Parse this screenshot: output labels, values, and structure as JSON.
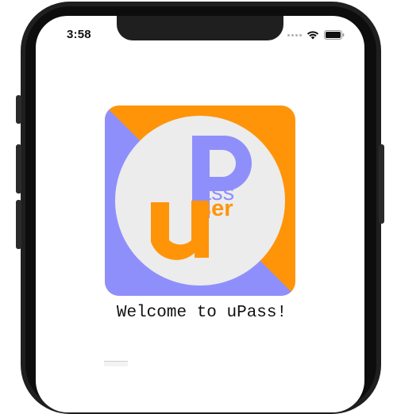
{
  "status_bar": {
    "time": "3:58",
    "signal_icon": "signal-dots-icon",
    "wifi_icon": "wifi-icon",
    "battery_icon": "battery-icon"
  },
  "logo": {
    "big_letter_u": "u",
    "big_letter_p": "P",
    "small_ass": "ass",
    "small_ser": "ser",
    "colors": {
      "orange": "#ff9409",
      "purple": "#8f8ffc",
      "circle": "#ececec"
    }
  },
  "main": {
    "welcome_text": "Welcome to uPass!"
  }
}
